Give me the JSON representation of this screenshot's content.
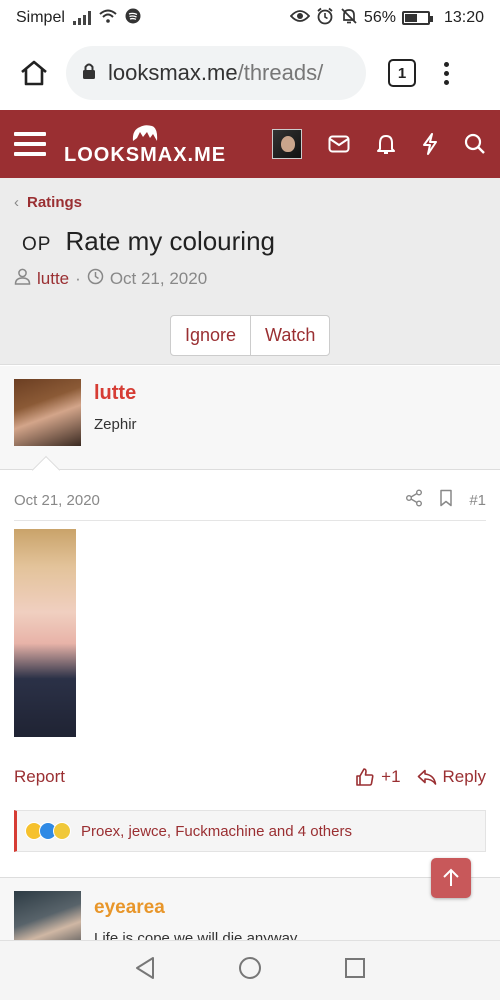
{
  "status_bar": {
    "carrier": "Simpel",
    "battery_percent": "56%",
    "battery_level": 0.56,
    "time": "13:20",
    "icons": [
      "signal-icon",
      "wifi-icon",
      "spotify-icon",
      "eye-icon",
      "alarm-icon",
      "mute-icon",
      "battery-icon"
    ]
  },
  "browser": {
    "url_host": "looksmax.me",
    "url_path": "/threads/",
    "tab_count": "1"
  },
  "site": {
    "logo_text": "LOOKSMAX.ME",
    "accent": "#9a2f32"
  },
  "thread": {
    "breadcrumb": "Ratings",
    "op_badge": "OP",
    "title": "Rate my colouring",
    "author": "lutte",
    "date": "Oct 21, 2020",
    "ignore_label": "Ignore",
    "watch_label": "Watch"
  },
  "post": {
    "username": "lutte",
    "user_title": "Zephir",
    "date": "Oct 21, 2020",
    "post_number": "#1",
    "report_label": "Report",
    "like_count": "+1",
    "reply_label": "Reply",
    "reactions_text": "Proex, jewce, Fuckmachine and 4 others"
  },
  "next_post": {
    "username": "eyearea",
    "user_title": "Life is cope we will die anyway"
  }
}
